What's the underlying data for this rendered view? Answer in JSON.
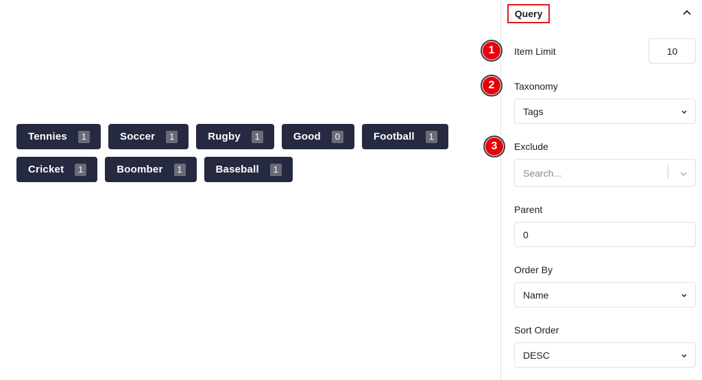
{
  "tags": [
    {
      "name": "Tennies",
      "count": "1"
    },
    {
      "name": "Soccer",
      "count": "1"
    },
    {
      "name": "Rugby",
      "count": "1"
    },
    {
      "name": "Good",
      "count": "0"
    },
    {
      "name": "Football",
      "count": "1"
    },
    {
      "name": "Cricket",
      "count": "1"
    },
    {
      "name": "Boomber",
      "count": "1"
    },
    {
      "name": "Baseball",
      "count": "1"
    }
  ],
  "sidebar": {
    "panel_title": "Query",
    "panel_toggle_icon": "chevron-up-icon",
    "markers": [
      "1",
      "2",
      "3"
    ],
    "item_limit": {
      "label": "Item Limit",
      "value": "10"
    },
    "taxonomy": {
      "label": "Taxonomy",
      "value": "Tags"
    },
    "exclude": {
      "label": "Exclude",
      "placeholder": "Search..."
    },
    "parent": {
      "label": "Parent",
      "value": "0"
    },
    "order_by": {
      "label": "Order By",
      "value": "Name"
    },
    "sort_order": {
      "label": "Sort Order",
      "value": "DESC"
    }
  },
  "colors": {
    "tag_bg": "#262a40",
    "marker": "#e8000b",
    "highlight_border": "#e3141b"
  }
}
